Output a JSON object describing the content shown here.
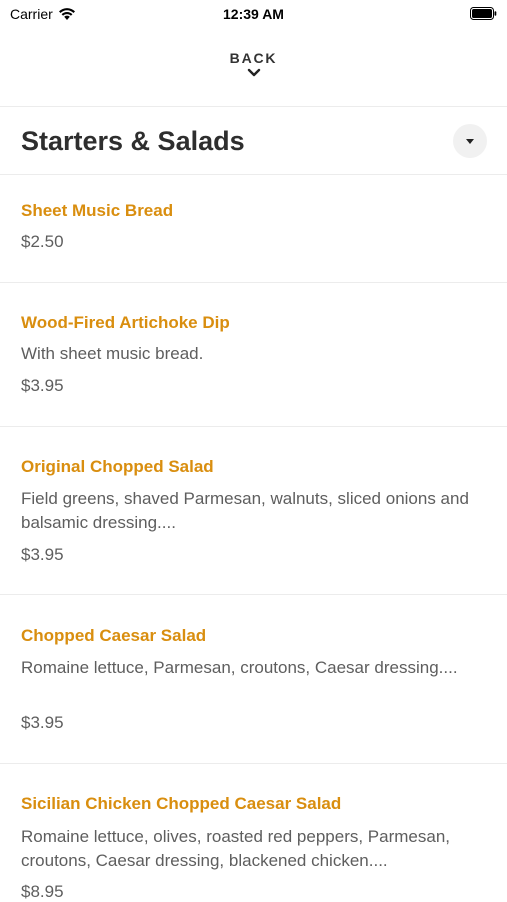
{
  "status_bar": {
    "carrier": "Carrier",
    "time": "12:39 AM"
  },
  "nav": {
    "back_label": "BACK"
  },
  "section": {
    "title": "Starters & Salads",
    "toggle_icon": "caret-down-icon"
  },
  "items": [
    {
      "name": "Sheet Music Bread",
      "description": "",
      "price": "$2.50"
    },
    {
      "name": "Wood-Fired Artichoke Dip",
      "description": "With sheet music bread.",
      "price": "$3.95"
    },
    {
      "name": "Original Chopped Salad",
      "description": "Field greens, shaved Parmesan, walnuts, sliced onions and balsamic dressing....",
      "price": "$3.95"
    },
    {
      "name": "Chopped Caesar Salad",
      "description": "Romaine lettuce, Parmesan, croutons, Caesar dressing....",
      "price": "$3.95"
    },
    {
      "name": "Sicilian Chicken Chopped Caesar Salad",
      "description": "Romaine lettuce, olives, roasted red peppers, Parmesan, croutons, Caesar dressing, blackened chicken....",
      "price": "$8.95"
    }
  ],
  "colors": {
    "item_name": "#d98e0f",
    "text_secondary": "#5e5e5e",
    "divider": "#ececec"
  }
}
